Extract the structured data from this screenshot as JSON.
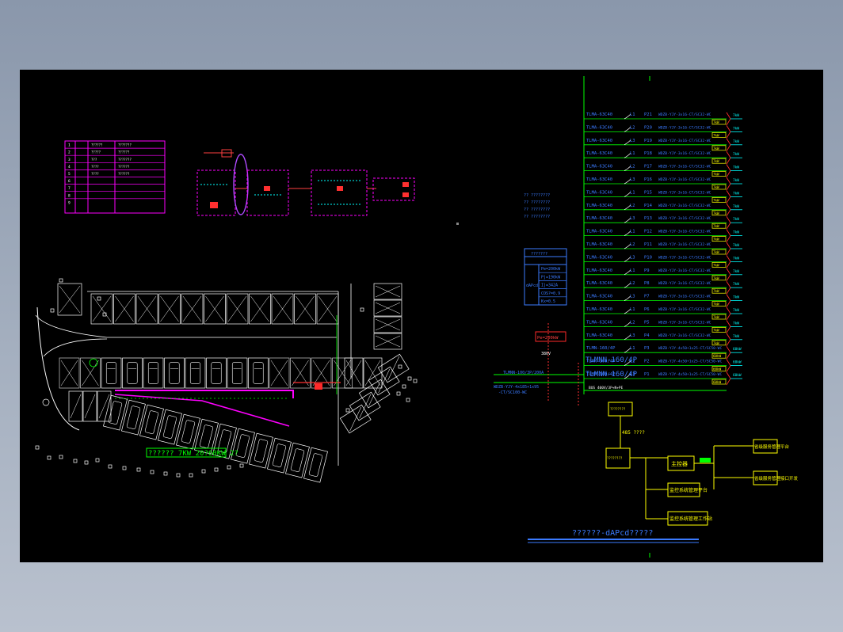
{
  "drawing": {
    "layout_plan": {
      "caption": "?????? 7KW 20?60KW 2?"
    },
    "system_diagram": {
      "title": "??????-dAPcd?????",
      "left_block": {
        "header": "???????",
        "rows": [
          "Pe=200kW",
          "Pj=190kW",
          "Ij=342A",
          "COS?=0.9",
          "Kx=0.5"
        ],
        "side_label": "dAPcd"
      },
      "feed": {
        "incoming_label": "TLMNN-100/3P/200A",
        "cable_label": "WDZB-YJY-4x185+1x95",
        "cable_label2": "-CT/SC100-WC",
        "meter_label": "Pe=200kW",
        "voltage_label": "380V"
      },
      "main_breakers": [
        "TLMNN-160/4P",
        "TLMNN-160/4P"
      ],
      "main_bus_label": "BUS 400V/3P+N+PE",
      "circuits": [
        {
          "breaker": "TLMA-63C40",
          "phase": "L1",
          "id": "P21",
          "cable": "WDZB-YJY-3x16-CT/SC32-WC",
          "load": "7kW"
        },
        {
          "breaker": "TLMA-63C40",
          "phase": "L2",
          "id": "P20",
          "cable": "WDZB-YJY-3x16-CT/SC32-WC",
          "load": "7kW"
        },
        {
          "breaker": "TLMA-63C40",
          "phase": "L3",
          "id": "P19",
          "cable": "WDZB-YJY-3x16-CT/SC32-WC",
          "load": "7kW"
        },
        {
          "breaker": "TLMA-63C40",
          "phase": "L1",
          "id": "P18",
          "cable": "WDZB-YJY-3x16-CT/SC32-WC",
          "load": "7kW"
        },
        {
          "breaker": "TLMA-63C40",
          "phase": "L2",
          "id": "P17",
          "cable": "WDZB-YJY-3x16-CT/SC32-WC",
          "load": "7kW"
        },
        {
          "breaker": "TLMA-63C40",
          "phase": "L3",
          "id": "P16",
          "cable": "WDZB-YJY-3x16-CT/SC32-WC",
          "load": "7kW"
        },
        {
          "breaker": "TLMA-63C40",
          "phase": "L1",
          "id": "P15",
          "cable": "WDZB-YJY-3x16-CT/SC32-WC",
          "load": "7kW"
        },
        {
          "breaker": "TLMA-63C40",
          "phase": "L2",
          "id": "P14",
          "cable": "WDZB-YJY-3x16-CT/SC32-WC",
          "load": "7kW"
        },
        {
          "breaker": "TLMA-63C40",
          "phase": "L3",
          "id": "P13",
          "cable": "WDZB-YJY-3x16-CT/SC32-WC",
          "load": "7kW"
        },
        {
          "breaker": "TLMA-63C40",
          "phase": "L1",
          "id": "P12",
          "cable": "WDZB-YJY-3x16-CT/SC32-WC",
          "load": "7kW"
        },
        {
          "breaker": "TLMA-63C40",
          "phase": "L2",
          "id": "P11",
          "cable": "WDZB-YJY-3x16-CT/SC32-WC",
          "load": "7kW"
        },
        {
          "breaker": "TLMA-63C40",
          "phase": "L3",
          "id": "P10",
          "cable": "WDZB-YJY-3x16-CT/SC32-WC",
          "load": "7kW"
        },
        {
          "breaker": "TLMA-63C40",
          "phase": "L1",
          "id": "P9",
          "cable": "WDZB-YJY-3x16-CT/SC32-WC",
          "load": "7kW"
        },
        {
          "breaker": "TLMA-63C40",
          "phase": "L2",
          "id": "P8",
          "cable": "WDZB-YJY-3x16-CT/SC32-WC",
          "load": "7kW"
        },
        {
          "breaker": "TLMA-63C40",
          "phase": "L3",
          "id": "P7",
          "cable": "WDZB-YJY-3x16-CT/SC32-WC",
          "load": "7kW"
        },
        {
          "breaker": "TLMA-63C40",
          "phase": "L1",
          "id": "P6",
          "cable": "WDZB-YJY-3x16-CT/SC32-WC",
          "load": "7kW"
        },
        {
          "breaker": "TLMA-63C40",
          "phase": "L2",
          "id": "P5",
          "cable": "WDZB-YJY-3x16-CT/SC32-WC",
          "load": "7kW"
        },
        {
          "breaker": "TLMA-63C40",
          "phase": "L3",
          "id": "P4",
          "cable": "WDZB-YJY-3x16-CT/SC32-WC",
          "load": "7kW"
        },
        {
          "breaker": "TLMN-160/4P",
          "phase": "L1",
          "id": "P3",
          "cable": "WDZB-YJY-4x50+1x25-CT/SC50-WC",
          "load": "60kW"
        },
        {
          "breaker": "TLMN-160/4P",
          "phase": "L2",
          "id": "P2",
          "cable": "WDZB-YJY-4x50+1x25-CT/SC50-WC",
          "load": "60kW"
        },
        {
          "breaker": "TLMN-160/4P",
          "phase": "L3",
          "id": "P1",
          "cable": "WDZB-YJY-4x50+1x25-CT/SC50-WC",
          "load": "60kW"
        }
      ],
      "control_blocks": {
        "gateway": "????????",
        "comm": "????????",
        "bus_label": "485 ????",
        "server": "???",
        "main_ctrl": "主控器",
        "workstation1": "监控系统管理平台",
        "workstation2": "监控系统管理工作站",
        "platform1": "省级服务管理平台",
        "platform2": "省级服务管理接口开发"
      },
      "notes_left": [
        "?? ????????",
        "?? ????????",
        "?? ????????",
        "?? ????????"
      ]
    },
    "legend_table": {
      "rows": [
        {
          "no": "1",
          "name": "??????",
          "spec": "???????"
        },
        {
          "no": "2",
          "name": "?????",
          "spec": "??????"
        },
        {
          "no": "3",
          "name": "???",
          "spec": "???????"
        },
        {
          "no": "4",
          "name": "????",
          "spec": "??????"
        },
        {
          "no": "5",
          "name": "????",
          "spec": "??????"
        },
        {
          "no": "6",
          "name": "",
          "spec": ""
        },
        {
          "no": "7",
          "name": "",
          "spec": ""
        },
        {
          "no": "8",
          "name": "",
          "spec": ""
        },
        {
          "no": "9",
          "name": "",
          "spec": ""
        }
      ]
    }
  },
  "colors": {
    "background": "#000000",
    "magenta": "#ff00ff",
    "cyan": "#00ffff",
    "yellow": "#ffff00",
    "green": "#00ff00",
    "red": "#ff0000",
    "blue": "#3b7bff",
    "white": "#ffffff"
  }
}
